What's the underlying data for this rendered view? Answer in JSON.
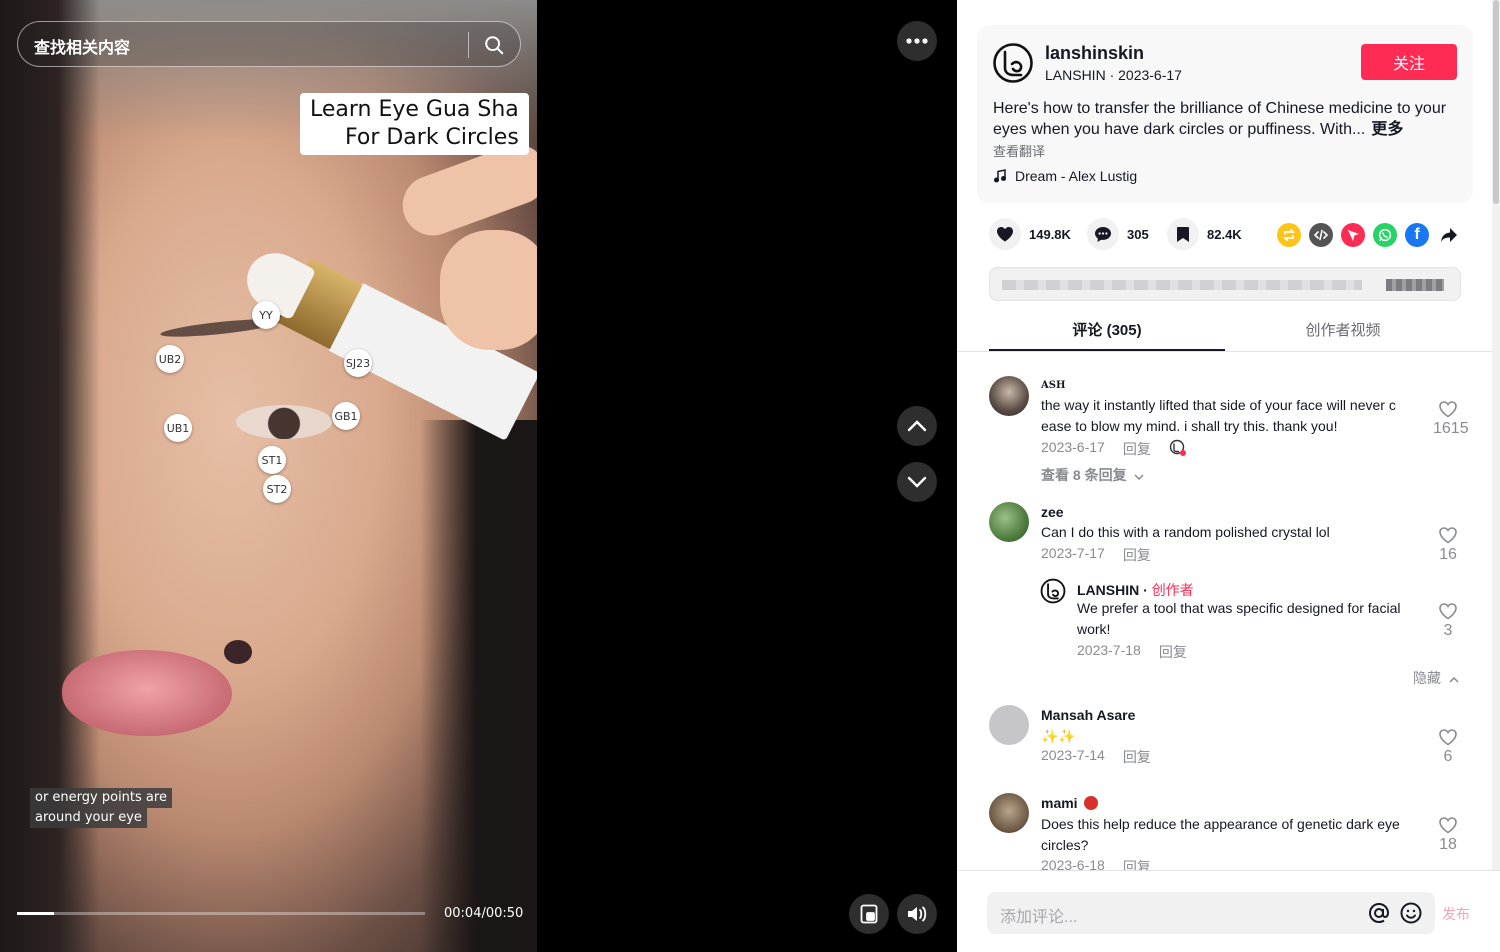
{
  "search": {
    "placeholder": "查找相关内容"
  },
  "video": {
    "title_line1": "Learn Eye Gua Sha",
    "title_line2": "For Dark Circles",
    "caption_line1": "or energy points are",
    "caption_line2": "around your eye",
    "points": [
      "YY",
      "UB2",
      "SJ23",
      "GB1",
      "UB1",
      "ST1",
      "ST2"
    ],
    "time": "00:04/00:50",
    "progress": 0.09
  },
  "author": {
    "id": "lanshinskin",
    "sub": "LANSHIN · 2023-6-17",
    "follow_label": "关注",
    "description": "Here's how to transfer the brilliance of Chinese medicine to your eyes when you have dark circles or puffiness. With...",
    "more_label": "更多",
    "translate_label": "查看翻译",
    "music": "Dream - Alex Lustig"
  },
  "stats": {
    "likes": "149.8K",
    "comments": "305",
    "saves": "82.4K"
  },
  "tabs": {
    "comments": "评论 (305)",
    "creator_videos": "创作者视频"
  },
  "comments": [
    {
      "name": "ASH",
      "text_line1": "the way it instantly lifted that side of your face will never c",
      "text_line2": "ease to blow my mind. i shall try this. thank you!",
      "date": "2023-6-17",
      "reply": "回复",
      "likes": "1615",
      "view_replies": "查看 8 条回复"
    },
    {
      "name": "zee",
      "text": "Can I do this with a random polished crystal lol",
      "date": "2023-7-17",
      "reply": "回复",
      "likes": "16"
    },
    {
      "name": "LANSHIN",
      "tag": "创作者",
      "text_line1": "We prefer a tool that was specific designed for facial",
      "text_line2": "work!",
      "date": "2023-7-18",
      "reply": "回复",
      "likes": "3",
      "hide": "隐藏"
    },
    {
      "name": "Mansah Asare",
      "text": "✨✨",
      "date": "2023-7-14",
      "reply": "回复",
      "likes": "6"
    },
    {
      "name": "mami",
      "text_line1": "Does this help reduce the appearance of genetic dark eye",
      "text_line2": "circles?",
      "date": "2023-6-18",
      "reply": "回复",
      "likes": "18"
    }
  ],
  "composer": {
    "placeholder": "添加评论...",
    "post_label": "发布"
  },
  "colors": {
    "accent": "#fe2c55",
    "text": "#161823",
    "muted": "#8a8b91"
  }
}
